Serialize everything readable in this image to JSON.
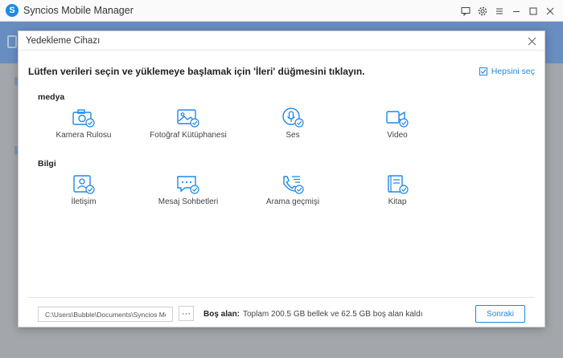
{
  "app": {
    "title": "Syncios Mobile Manager",
    "logo_glyph": "S"
  },
  "window_controls": {
    "icons": [
      "message-icon",
      "settings-icon",
      "menu-icon",
      "minimize-icon",
      "maximize-icon",
      "close-icon"
    ]
  },
  "dialog": {
    "title": "Yedekleme Cihazı",
    "instruction": "Lütfen verileri seçin ve yüklemeye başlamak için 'İleri' düğmesini tıklayın.",
    "select_all_label": "Hepsini seç",
    "select_all_checked": true,
    "sections": [
      {
        "label": "medya",
        "items": [
          {
            "label": "Kamera Rulosu",
            "icon": "camera-icon"
          },
          {
            "label": "Fotoğraf Kütüphanesi",
            "icon": "photo-icon"
          },
          {
            "label": "Ses",
            "icon": "microphone-icon"
          },
          {
            "label": "Video",
            "icon": "video-icon"
          }
        ]
      },
      {
        "label": "Bilgi",
        "items": [
          {
            "label": "İletişim",
            "icon": "contacts-icon"
          },
          {
            "label": "Mesaj Sohbetleri",
            "icon": "message-icon"
          },
          {
            "label": "Arama geçmişi",
            "icon": "phone-icon"
          },
          {
            "label": "Kitap",
            "icon": "book-icon"
          }
        ]
      }
    ],
    "footer": {
      "path_value": "C:\\Users\\Bubble\\Documents\\Syncios Mobile",
      "browse_label": "···",
      "free_space_label": "Boş alan:",
      "free_space_text": "Toplam 200.5 GB bellek ve 62.5 GB boş alan kaldı",
      "next_button": "Sonraki"
    }
  },
  "colors": {
    "accent": "#1e88e5",
    "header_bg": "#3a7bd5"
  }
}
